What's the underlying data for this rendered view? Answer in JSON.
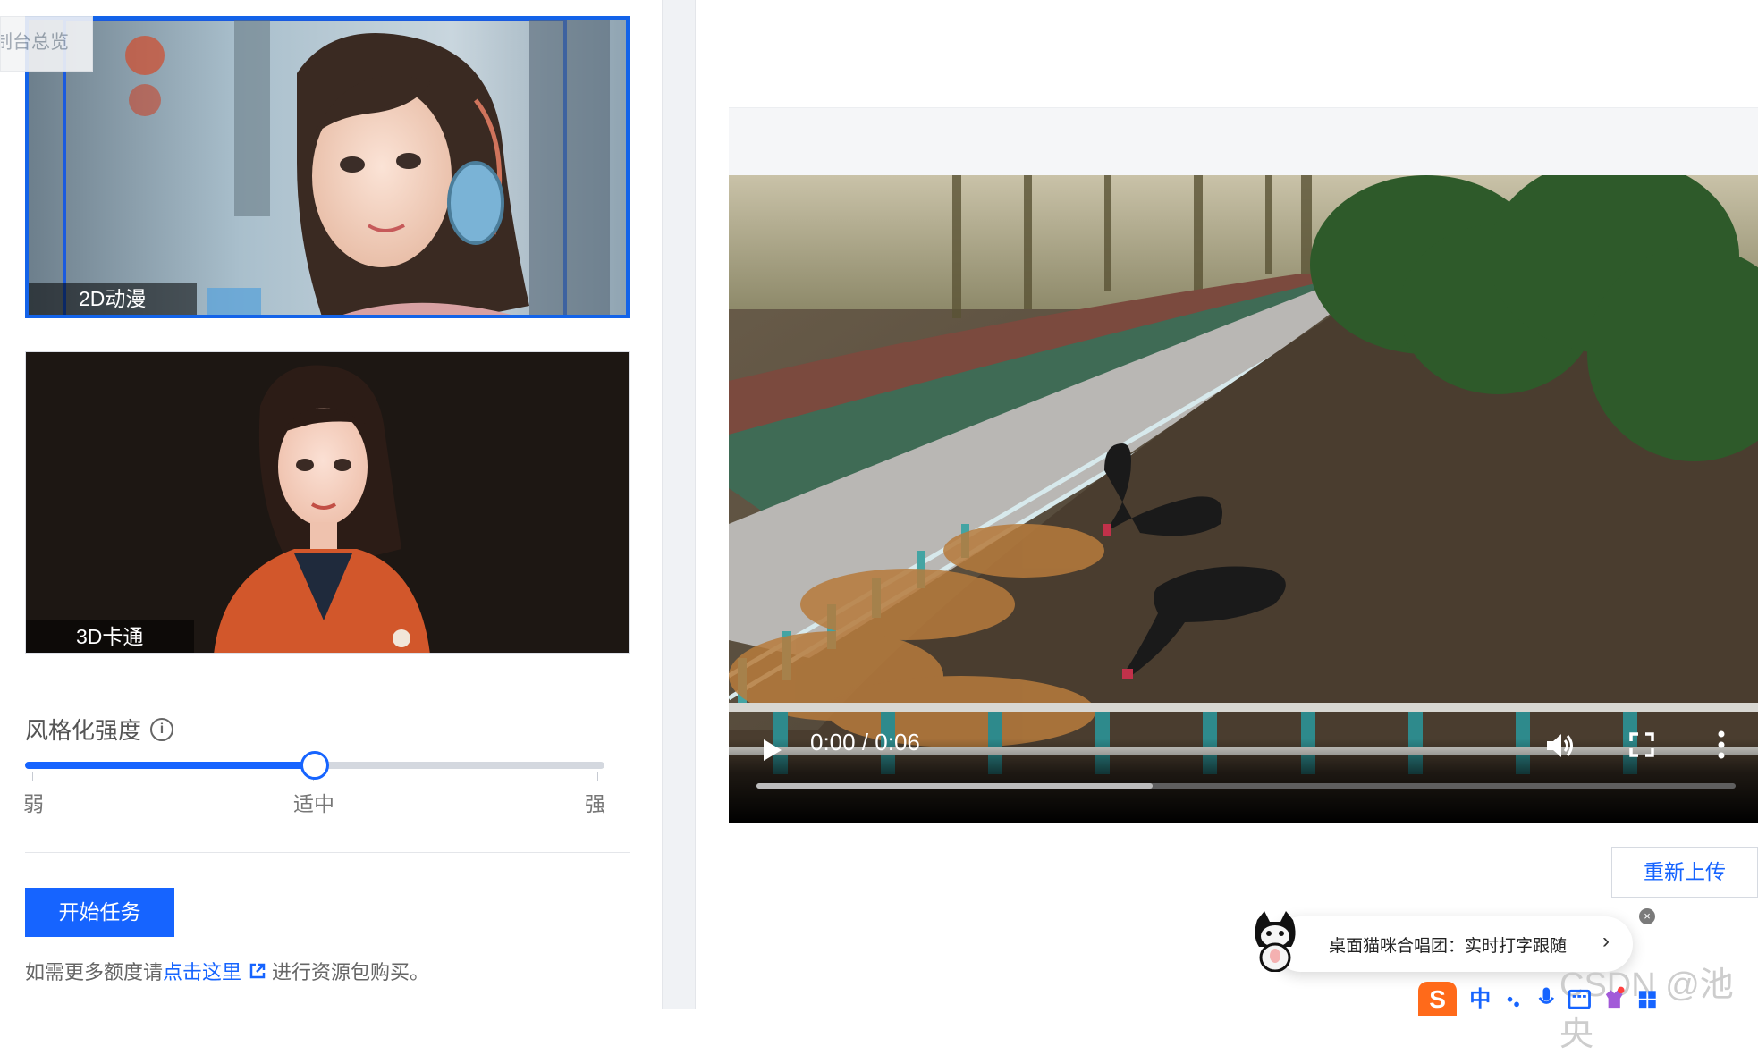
{
  "overview_tab": {
    "label": "制台总览"
  },
  "style_cards": [
    {
      "label": "2D动漫",
      "selected": true
    },
    {
      "label": "3D卡通",
      "selected": false
    }
  ],
  "strength": {
    "label": "风格化强度",
    "info_icon": "info-icon",
    "value_fraction": 0.5,
    "marks": [
      "弱",
      "适中",
      "强"
    ]
  },
  "actions": {
    "start_label": "开始任务",
    "tip_prefix": "如需更多额度请",
    "tip_link": "点击这里",
    "tip_suffix": "进行资源包购买。"
  },
  "video": {
    "time": "0:00 / 0:06",
    "played_fraction": 0,
    "buffered_fraction": 0.405
  },
  "reupload_label": "重新上传",
  "toast": {
    "text": "桌面猫咪合唱团：实时打字跟随",
    "arrow": "›",
    "close": "×"
  },
  "watermark": "CSDN @池央",
  "ime": {
    "logo": "S",
    "lang": "中"
  },
  "colors": {
    "primary": "#1664ff",
    "selected_border": "#1363e9"
  }
}
